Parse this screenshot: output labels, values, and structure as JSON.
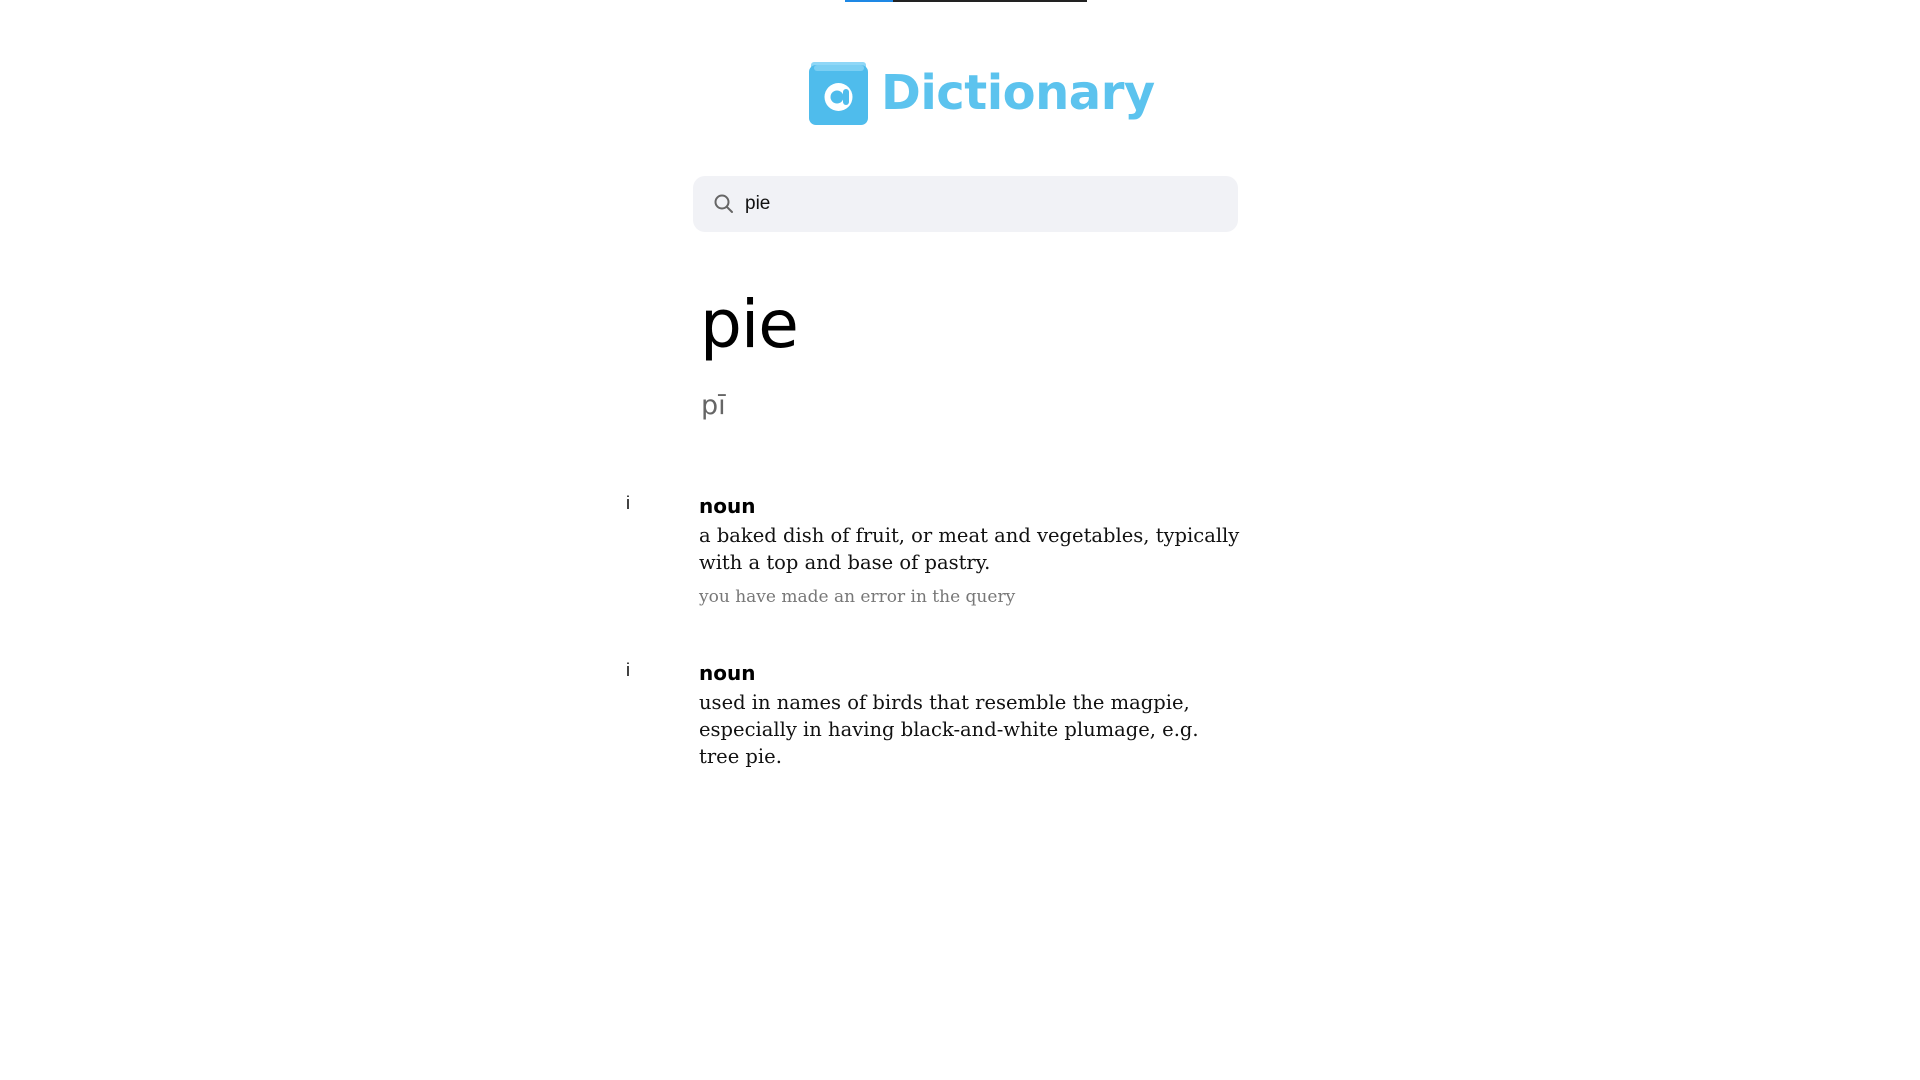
{
  "progress": {
    "value": 0.2
  },
  "logo": {
    "icon_letter": "a",
    "wordmark": "Dictionary",
    "color": "#5cc3ee"
  },
  "search": {
    "icon": "search-icon",
    "value": "pie"
  },
  "word": {
    "headword": "pie",
    "phonetic": "pī"
  },
  "entries": [
    {
      "index": "i",
      "part_of_speech": "noun",
      "definition": "a baked dish of fruit, or meat and vegetables, typically with a top and base of pastry.",
      "note": "you have made an error in the query"
    },
    {
      "index": "i",
      "part_of_speech": "noun",
      "definition": "used in names of birds that resemble the magpie, especially in having black-and-white plumage, e.g. tree pie."
    }
  ]
}
